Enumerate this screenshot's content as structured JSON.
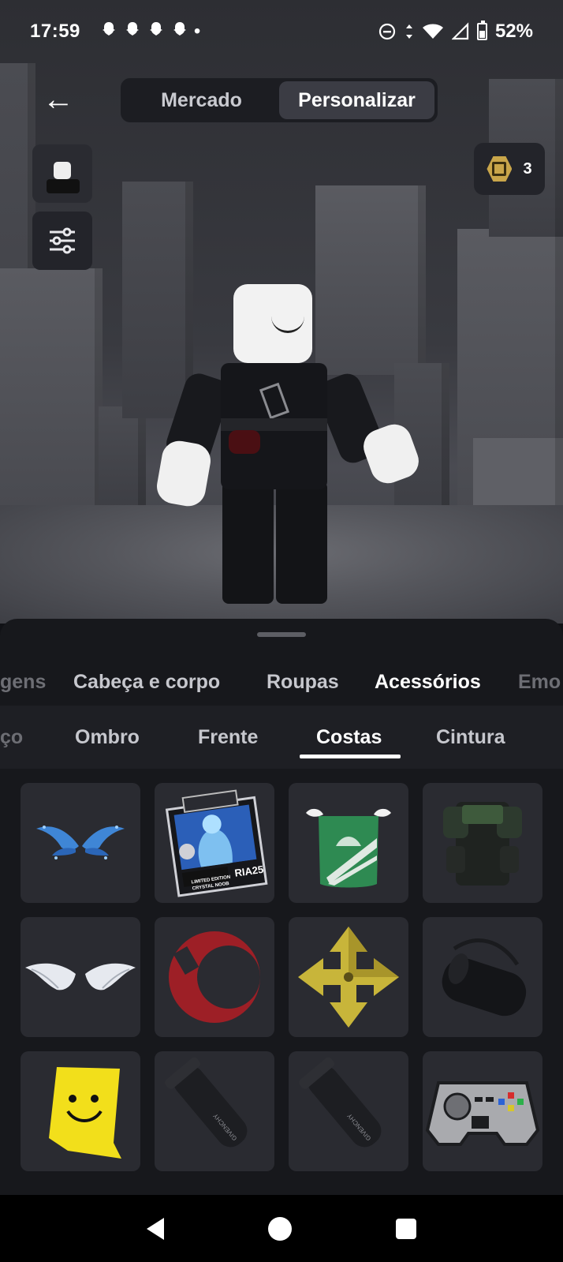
{
  "status_bar": {
    "time": "17:59",
    "notification_icons": [
      "snapchat-icon",
      "snapchat-icon",
      "snapchat-icon",
      "snapchat-icon"
    ],
    "more_dot": "•",
    "battery": "52%"
  },
  "top_nav": {
    "back_icon": "←",
    "tabs": [
      {
        "label": "Mercado",
        "active": false
      },
      {
        "label": "Personalizar",
        "active": true
      }
    ],
    "robux_count": "3"
  },
  "categories": [
    {
      "label": "gens",
      "state": "faded"
    },
    {
      "label": "Cabeça e corpo",
      "state": "normal"
    },
    {
      "label": "Roupas",
      "state": "normal"
    },
    {
      "label": "Acessórios",
      "state": "active"
    },
    {
      "label": "Emo",
      "state": "faded"
    }
  ],
  "subcategories": [
    {
      "label": "ço",
      "state": "faded"
    },
    {
      "label": "Ombro",
      "state": "normal"
    },
    {
      "label": "Frente",
      "state": "normal"
    },
    {
      "label": "Costas",
      "state": "active"
    },
    {
      "label": "Cintura",
      "state": "normal"
    }
  ],
  "items": [
    {
      "name": "blue-wings-item",
      "text": ""
    },
    {
      "name": "innovation-awards-badge-item",
      "text": "LIMITED EDITION CRYSTAL NOOB RIA25"
    },
    {
      "name": "green-cape-item",
      "text": ""
    },
    {
      "name": "green-backpack-item",
      "text": ""
    },
    {
      "name": "white-wings-item",
      "text": ""
    },
    {
      "name": "red-crescent-item",
      "text": ""
    },
    {
      "name": "yellow-arrows-item",
      "text": ""
    },
    {
      "name": "duffel-bag-item",
      "text": ""
    },
    {
      "name": "smiley-cape-item",
      "text": ""
    },
    {
      "name": "givenchy-tube-item",
      "text": "GIVENCHY"
    },
    {
      "name": "givenchy-tube-item-2",
      "text": "GIVENCHY"
    },
    {
      "name": "pixel-controller-item",
      "text": ""
    }
  ]
}
